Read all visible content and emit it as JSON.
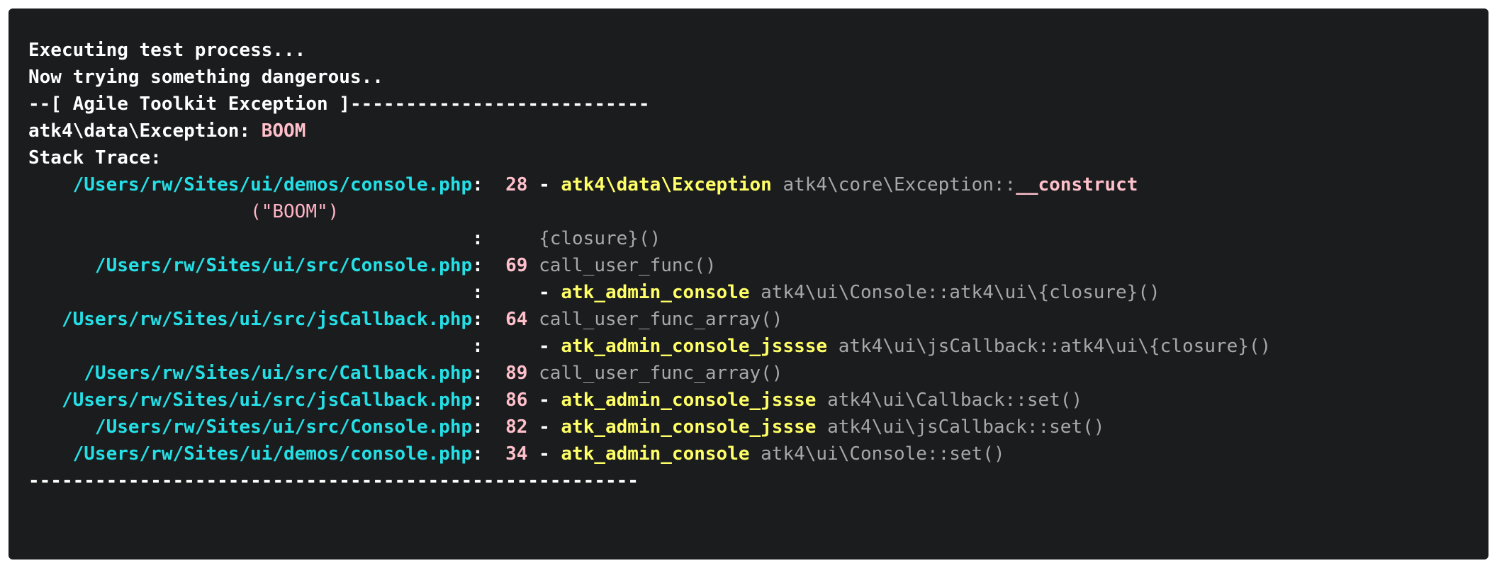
{
  "console": {
    "lines": [
      {
        "segments": [
          {
            "text": "Executing test process...",
            "style": "white bold"
          }
        ]
      },
      {
        "segments": [
          {
            "text": "Now trying something dangerous..",
            "style": "white bold"
          }
        ]
      },
      {
        "segments": [
          {
            "text": "--[ Agile Toolkit Exception ]---------------------------",
            "style": "white bold"
          }
        ]
      },
      {
        "segments": [
          {
            "text": "atk4\\data\\Exception: ",
            "style": "white bold"
          },
          {
            "text": "BOOM",
            "style": "pink"
          }
        ]
      },
      {
        "segments": [
          {
            "text": "Stack Trace:",
            "style": "white bold"
          }
        ]
      },
      {
        "segments": [
          {
            "text": "    /Users/rw/Sites/ui/demos/console.php",
            "style": "cyan"
          },
          {
            "text": ":  ",
            "style": "white bold"
          },
          {
            "text": "28",
            "style": "pink"
          },
          {
            "text": " - ",
            "style": "white bold"
          },
          {
            "text": "atk4\\data\\Exception",
            "style": "yellow"
          },
          {
            "text": " atk4\\core\\Exception::",
            "style": "grey"
          },
          {
            "text": "__construct",
            "style": "pink"
          }
        ]
      },
      {
        "segments": [
          {
            "text": "                    (\"BOOM\")",
            "style": "pinklight"
          }
        ]
      },
      {
        "segments": [
          {
            "text": "                                        :     ",
            "style": "white bold"
          },
          {
            "text": "{closure}()",
            "style": "grey"
          }
        ]
      },
      {
        "segments": [
          {
            "text": "      /Users/rw/Sites/ui/src/Console.php",
            "style": "cyan"
          },
          {
            "text": ":  ",
            "style": "white bold"
          },
          {
            "text": "69",
            "style": "pink"
          },
          {
            "text": " call_user_func()",
            "style": "grey"
          }
        ]
      },
      {
        "segments": [
          {
            "text": "                                        :     - ",
            "style": "white bold"
          },
          {
            "text": "atk_admin_console",
            "style": "yellow"
          },
          {
            "text": " atk4\\ui\\Console::atk4\\ui\\{closure}()",
            "style": "grey"
          }
        ]
      },
      {
        "segments": [
          {
            "text": "   /Users/rw/Sites/ui/src/jsCallback.php",
            "style": "cyan"
          },
          {
            "text": ":  ",
            "style": "white bold"
          },
          {
            "text": "64",
            "style": "pink"
          },
          {
            "text": " call_user_func_array()",
            "style": "grey"
          }
        ]
      },
      {
        "segments": [
          {
            "text": "                                        :     - ",
            "style": "white bold"
          },
          {
            "text": "atk_admin_console_jsssse",
            "style": "yellow"
          },
          {
            "text": " atk4\\ui\\jsCallback::atk4\\ui\\{closure}()",
            "style": "grey"
          }
        ]
      },
      {
        "segments": [
          {
            "text": "     /Users/rw/Sites/ui/src/Callback.php",
            "style": "cyan"
          },
          {
            "text": ":  ",
            "style": "white bold"
          },
          {
            "text": "89",
            "style": "pink"
          },
          {
            "text": " call_user_func_array()",
            "style": "grey"
          }
        ]
      },
      {
        "segments": [
          {
            "text": "   /Users/rw/Sites/ui/src/jsCallback.php",
            "style": "cyan"
          },
          {
            "text": ":  ",
            "style": "white bold"
          },
          {
            "text": "86",
            "style": "pink"
          },
          {
            "text": " - ",
            "style": "white bold"
          },
          {
            "text": "atk_admin_console_jssse",
            "style": "yellow"
          },
          {
            "text": " atk4\\ui\\Callback::set()",
            "style": "grey"
          }
        ]
      },
      {
        "segments": [
          {
            "text": "      /Users/rw/Sites/ui/src/Console.php",
            "style": "cyan"
          },
          {
            "text": ":  ",
            "style": "white bold"
          },
          {
            "text": "82",
            "style": "pink"
          },
          {
            "text": " - ",
            "style": "white bold"
          },
          {
            "text": "atk_admin_console_jssse",
            "style": "yellow"
          },
          {
            "text": " atk4\\ui\\jsCallback::set()",
            "style": "grey"
          }
        ]
      },
      {
        "segments": [
          {
            "text": "    /Users/rw/Sites/ui/demos/console.php",
            "style": "cyan"
          },
          {
            "text": ":  ",
            "style": "white bold"
          },
          {
            "text": "34",
            "style": "pink"
          },
          {
            "text": " - ",
            "style": "white bold"
          },
          {
            "text": "atk_admin_console",
            "style": "yellow"
          },
          {
            "text": " atk4\\ui\\Console::set()",
            "style": "grey"
          }
        ]
      },
      {
        "segments": [
          {
            "text": "-------------------------------------------------------",
            "style": "white bold"
          }
        ]
      }
    ]
  },
  "colors": {
    "background": "#1b1c1d",
    "cyan": "#24e0e6",
    "yellow": "#ffff66",
    "pink": "#ffc0cb",
    "grey": "#a8a8a8"
  }
}
